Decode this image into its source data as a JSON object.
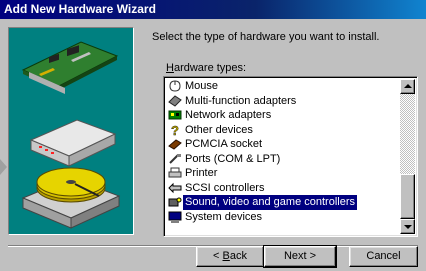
{
  "window": {
    "title": "Add New Hardware Wizard"
  },
  "prompt": "Select the type of hardware you want to install.",
  "hardware_types": {
    "label_accel": "H",
    "label_rest": "ardware types:",
    "items": [
      {
        "label": "Mouse",
        "icon": "mouse-icon"
      },
      {
        "label": "Multi-function adapters",
        "icon": "adapter-icon"
      },
      {
        "label": "Network adapters",
        "icon": "network-icon"
      },
      {
        "label": "Other devices",
        "icon": "question-icon"
      },
      {
        "label": "PCMCIA socket",
        "icon": "pcmcia-icon"
      },
      {
        "label": "Ports (COM & LPT)",
        "icon": "port-icon"
      },
      {
        "label": "Printer",
        "icon": "printer-icon"
      },
      {
        "label": "SCSI controllers",
        "icon": "scsi-icon"
      },
      {
        "label": "Sound, video and game controllers",
        "icon": "sound-icon",
        "selected": true
      },
      {
        "label": "System devices",
        "icon": "computer-icon"
      }
    ]
  },
  "buttons": {
    "back_prefix": "< ",
    "back_accel": "B",
    "back_rest": "ack",
    "next": "Next >",
    "cancel": "Cancel"
  },
  "colors": {
    "title_bar": "#000080",
    "art_background": "#008080",
    "selection": "#000080",
    "face": "#c0c0c0"
  }
}
